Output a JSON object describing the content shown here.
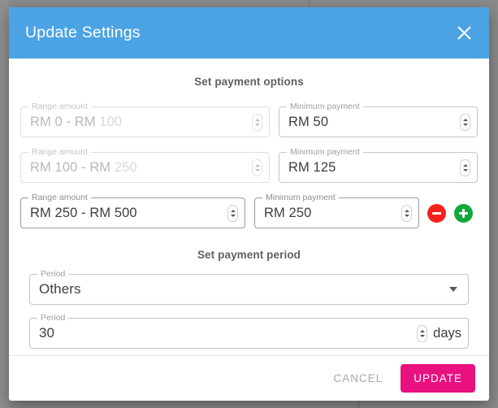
{
  "backdrop": {
    "color": "#8a8a8a"
  },
  "dialog": {
    "title": "Update Settings",
    "header_color": "#4ba3e3",
    "close_icon": "close-icon"
  },
  "payment_options": {
    "section_title": "Set payment options",
    "range_label": "Range amount",
    "minimum_label": "Minimum payment",
    "rows": [
      {
        "disabled": true,
        "range_value_prefix": "RM 0 - RM ",
        "range_value_suffix": "100",
        "minimum_value": "RM 50"
      },
      {
        "disabled": true,
        "range_value_prefix": "RM 100 - RM ",
        "range_value_suffix": "250",
        "minimum_value": "RM 125"
      },
      {
        "disabled": false,
        "range_value_prefix": "RM 250 - RM 500",
        "range_value_suffix": "",
        "minimum_value": "RM 250"
      }
    ],
    "remove_button": {
      "icon": "minus-icon",
      "color": "#f5221b"
    },
    "add_button": {
      "icon": "plus-icon",
      "color": "#12a83a"
    }
  },
  "payment_period": {
    "section_title": "Set payment period",
    "select_label": "Period",
    "select_value": "Others",
    "number_label": "Period",
    "number_value": "30",
    "number_suffix": "days"
  },
  "footer": {
    "cancel_label": "CANCEL",
    "update_label": "UPDATE",
    "update_color": "#e9107f"
  }
}
